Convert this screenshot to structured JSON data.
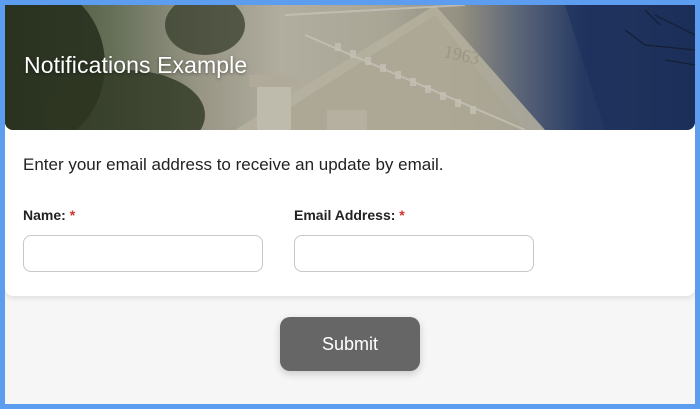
{
  "header": {
    "title": "Notifications Example",
    "image_description": "banner-photo"
  },
  "form": {
    "intro_text": "Enter your email address to receive an update by email.",
    "fields": [
      {
        "label": "Name:",
        "required_marker": "*",
        "value": "",
        "placeholder": ""
      },
      {
        "label": "Email Address:",
        "required_marker": "*",
        "value": "",
        "placeholder": ""
      }
    ],
    "submit_label": "Submit"
  },
  "colors": {
    "frame_border": "#5d9df0",
    "required": "#d0342c",
    "submit_bg": "#666666"
  }
}
